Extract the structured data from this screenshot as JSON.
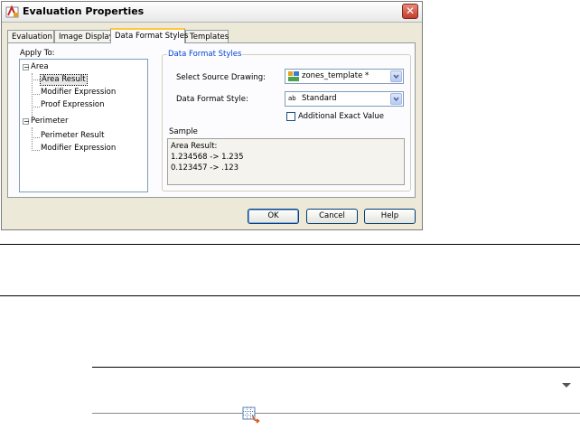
{
  "dialog": {
    "title": "Evaluation Properties",
    "close_label": "✕",
    "tabs": [
      {
        "label": "Evaluation"
      },
      {
        "label": "Image Display"
      },
      {
        "label": "Data Format Styles",
        "active": true
      },
      {
        "label": "Templates"
      }
    ],
    "apply_to_label": "Apply To:",
    "tree": {
      "area": "Area",
      "area_result": "Area Result",
      "modifier_expression": "Modifier Expression",
      "proof_expression": "Proof Expression",
      "perimeter": "Perimeter",
      "perimeter_result": "Perimeter Result",
      "perimeter_modifier_expression": "Modifier Expression",
      "expander_minus": "−"
    },
    "group_title": "Data Format Styles",
    "select_source_label": "Select Source Drawing:",
    "source_value": "zones_template *",
    "data_format_style_label": "Data Format Style:",
    "format_value": "Standard",
    "format_icon_text": "ab",
    "additional_exact_label": "Additional Exact Value",
    "sample_label": "Sample",
    "sample_lines": [
      "Area Result:",
      "1.234568 -> 1.235",
      "0.123457 -> .123"
    ],
    "buttons": {
      "ok": "OK",
      "cancel": "Cancel",
      "help": "Help"
    }
  },
  "colors": {
    "title_close": "#c33c2a",
    "active_tab_accent": "#ffc73c",
    "group_title": "#0046d5"
  }
}
